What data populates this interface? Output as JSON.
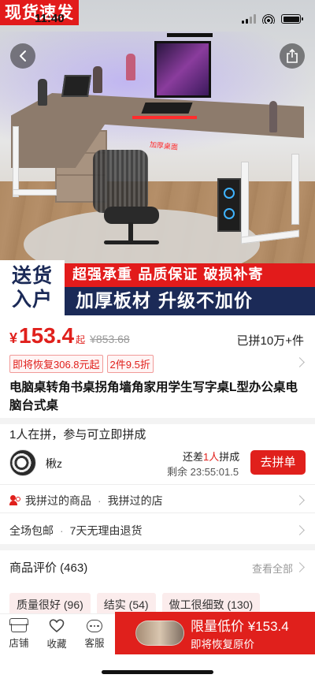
{
  "status_bar": {
    "time": "11:40"
  },
  "hero": {
    "badge": "现货速发",
    "desk_mark": "加厚桌面",
    "banner_left": [
      "送货",
      "入户"
    ],
    "banner_red": "超强承重 品质保证 破损补寄",
    "banner_navy": "加厚板材 升级不加价"
  },
  "price": {
    "symbol": "¥",
    "value": "153.4",
    "qi": "起",
    "original": "¥853.68",
    "sold": "已拼10万+件"
  },
  "promos": [
    "即将恢复306.8元起",
    "2件9.5折"
  ],
  "product_title": "电脑桌转角书桌拐角墙角家用学生写字桌L型办公桌电脑台式桌",
  "group": {
    "summary": "1人在拼，参与可立即拼成",
    "user_name": "楸z",
    "need_prefix": "还差",
    "need_count": "1人",
    "need_suffix": "拼成",
    "remaining": "剩余 23:55:01.5",
    "join_label": "去拼单"
  },
  "history": {
    "item1": "我拼过的商品",
    "item2": "我拼过的店"
  },
  "services": {
    "item1": "全场包邮",
    "item2": "7天无理由退货"
  },
  "reviews": {
    "title": "商品评价 (463)",
    "view_all": "查看全部",
    "tags": [
      "质量很好 (96)",
      "结实 (54)",
      "做工很细致 (130)"
    ]
  },
  "bottom_bar": {
    "store": "店铺",
    "favorite": "收藏",
    "service": "客服",
    "buy_main": "限量低价 ¥153.4",
    "buy_sub": "即将恢复原价"
  },
  "colors": {
    "accent": "#e0201c",
    "navy": "#1b2a57"
  },
  "icons": [
    "back-icon",
    "share-icon",
    "people-icon",
    "store-icon",
    "heart-icon",
    "chat-icon"
  ]
}
